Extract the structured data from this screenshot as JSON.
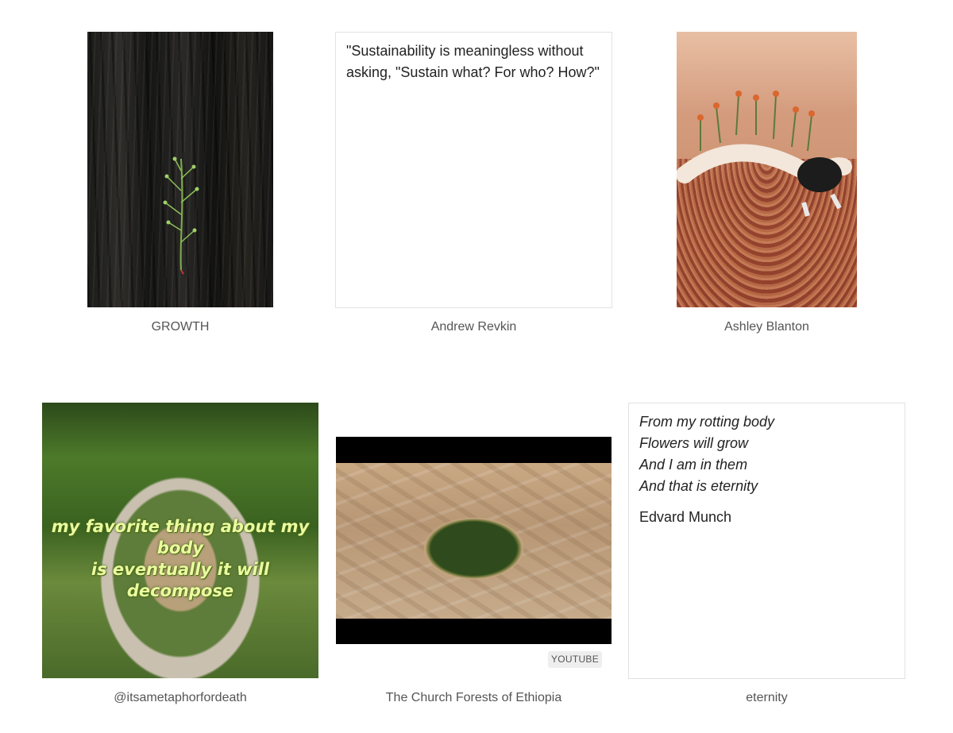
{
  "row1": {
    "growth": {
      "caption": "GROWTH",
      "image_icon": "charred-bark-sprig-image"
    },
    "quote": {
      "text": "\"Sustainability is meaningless without asking, \"Sustain what? For who? How?\"",
      "caption": "Andrew Revkin"
    },
    "artwork": {
      "caption": "Ashley Blanton",
      "image_icon": "figure-with-flowers-image"
    }
  },
  "row2": {
    "garden": {
      "overlay_line1": "my favorite thing about my body",
      "overlay_line2": "is eventually it will decompose",
      "caption": "@itsametaphorfordeath"
    },
    "video": {
      "badge": "YOUTUBE",
      "caption": "The Church Forests of Ethiopia"
    },
    "poem": {
      "lines": [
        "From my rotting body",
        "Flowers will grow",
        "And I am in them",
        "And that is eternity"
      ],
      "author": "Edvard Munch",
      "caption": "eternity"
    }
  }
}
